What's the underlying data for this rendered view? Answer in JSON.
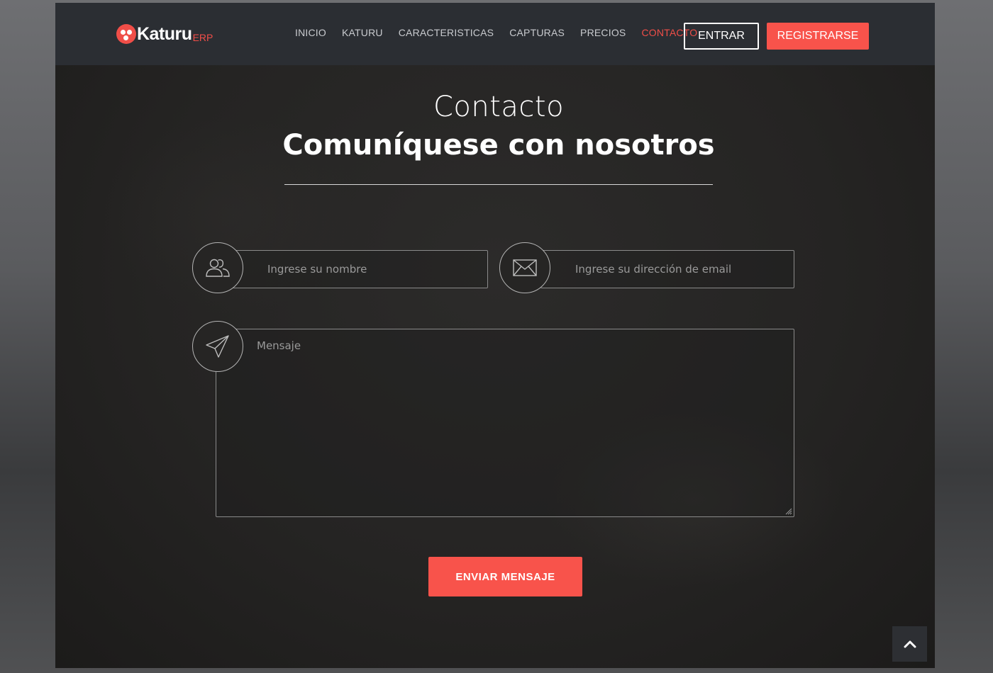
{
  "header": {
    "logo": {
      "name": "Katuru",
      "suffix": "ERP",
      "icon": "katuru-logo-icon"
    },
    "nav": [
      {
        "label": "INICIO",
        "active": false
      },
      {
        "label": "KATURU",
        "active": false
      },
      {
        "label": "CARACTERISTICAS",
        "active": false
      },
      {
        "label": "CAPTURAS",
        "active": false
      },
      {
        "label": "PRECIOS",
        "active": false
      },
      {
        "label": "CONTACTO",
        "active": true
      }
    ],
    "login_label": "ENTRAR",
    "register_label": "REGISTRARSE"
  },
  "contact": {
    "title": "Contacto",
    "subtitle": "Comuníquese con nosotros",
    "form": {
      "name_placeholder": "Ingrese su nombre",
      "email_placeholder": "Ingrese su dirección de email",
      "message_placeholder": "Mensaje",
      "name_icon": "users-icon",
      "email_icon": "envelope-icon",
      "message_icon": "paper-plane-icon",
      "submit_label": "ENVIAR MENSAJE"
    }
  },
  "scroll_top_icon": "chevron-up-icon",
  "colors": {
    "accent": "#f8534b",
    "header_bg": "#2b2e33",
    "page_bg": "#252423"
  }
}
